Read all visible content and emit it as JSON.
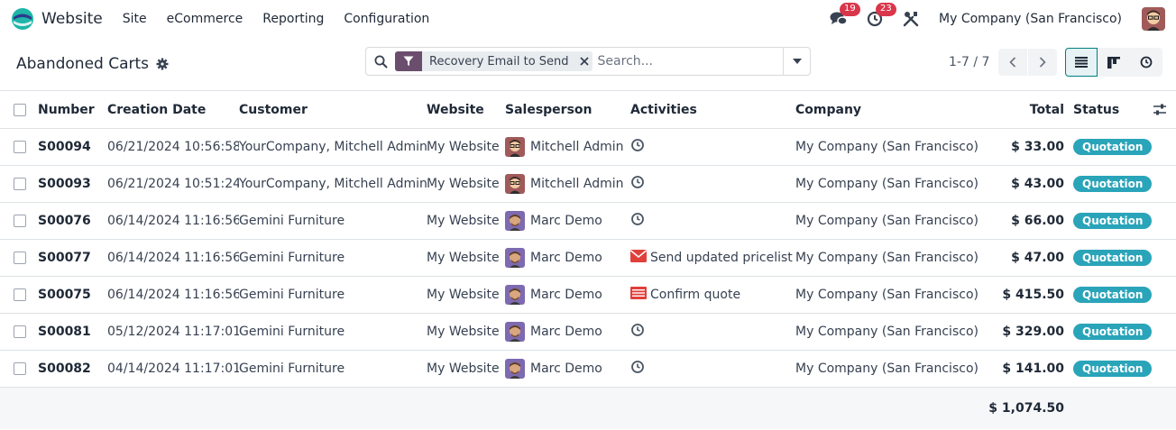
{
  "app": {
    "name": "Website",
    "menu": [
      "Site",
      "eCommerce",
      "Reporting",
      "Configuration"
    ],
    "messages_count": "19",
    "activities_count": "23",
    "company": "My Company (San Francisco)"
  },
  "control": {
    "title": "Abandoned Carts",
    "facet_label": "Recovery Email to Send",
    "search_placeholder": "Search...",
    "pager": "1-7 / 7"
  },
  "table": {
    "headers": {
      "number": "Number",
      "date": "Creation Date",
      "customer": "Customer",
      "website": "Website",
      "salesperson": "Salesperson",
      "activities": "Activities",
      "company": "Company",
      "total": "Total",
      "status": "Status"
    },
    "rows": [
      {
        "number": "S00094",
        "date": "06/21/2024 10:56:58",
        "customer": "YourCompany, Mitchell Admin",
        "website": "My Website",
        "salesperson": "Mitchell Admin",
        "avatar": "admin",
        "activity": "",
        "activity_icon": "clock-icon",
        "company": "My Company (San Francisco)",
        "total": "$ 33.00",
        "status": "Quotation"
      },
      {
        "number": "S00093",
        "date": "06/21/2024 10:51:24",
        "customer": "YourCompany, Mitchell Admin",
        "website": "My Website",
        "salesperson": "Mitchell Admin",
        "avatar": "admin",
        "activity": "",
        "activity_icon": "clock-icon",
        "company": "My Company (San Francisco)",
        "total": "$ 43.00",
        "status": "Quotation"
      },
      {
        "number": "S00076",
        "date": "06/14/2024 11:16:56",
        "customer": "Gemini Furniture",
        "website": "My Website",
        "salesperson": "Marc Demo",
        "avatar": "demo",
        "activity": "",
        "activity_icon": "clock-icon",
        "company": "My Company (San Francisco)",
        "total": "$ 66.00",
        "status": "Quotation"
      },
      {
        "number": "S00077",
        "date": "06/14/2024 11:16:56",
        "customer": "Gemini Furniture",
        "website": "My Website",
        "salesperson": "Marc Demo",
        "avatar": "demo",
        "activity": "Send updated pricelist",
        "activity_icon": "envelope-icon",
        "company": "My Company (San Francisco)",
        "total": "$ 47.00",
        "status": "Quotation"
      },
      {
        "number": "S00075",
        "date": "06/14/2024 11:16:56",
        "customer": "Gemini Furniture",
        "website": "My Website",
        "salesperson": "Marc Demo",
        "avatar": "demo",
        "activity": "Confirm quote",
        "activity_icon": "list-icon",
        "company": "My Company (San Francisco)",
        "total": "$ 415.50",
        "status": "Quotation"
      },
      {
        "number": "S00081",
        "date": "05/12/2024 11:17:01",
        "customer": "Gemini Furniture",
        "website": "My Website",
        "salesperson": "Marc Demo",
        "avatar": "demo",
        "activity": "",
        "activity_icon": "clock-icon",
        "company": "My Company (San Francisco)",
        "total": "$ 329.00",
        "status": "Quotation"
      },
      {
        "number": "S00082",
        "date": "04/14/2024 11:17:01",
        "customer": "Gemini Furniture",
        "website": "My Website",
        "salesperson": "Marc Demo",
        "avatar": "demo",
        "activity": "",
        "activity_icon": "clock-icon",
        "company": "My Company (San Francisco)",
        "total": "$ 141.00",
        "status": "Quotation"
      }
    ],
    "grand_total": "$ 1,074.50"
  },
  "colors": {
    "accent": "#017e84",
    "facet": "#6b4d6d",
    "badge": "#d9364b",
    "status": "#2aa4b9",
    "activity_red": "#e0403a"
  }
}
